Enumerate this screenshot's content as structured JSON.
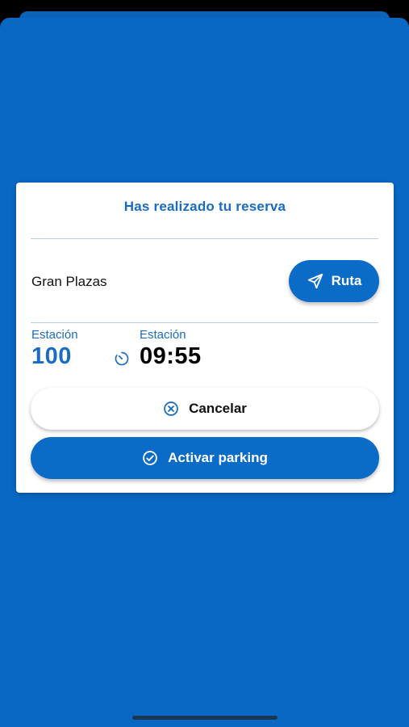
{
  "dialog": {
    "title": "Has realizado tu reserva",
    "place_name": "Gran Plazas",
    "route_button": {
      "label": "Ruta",
      "icon": "send-icon"
    },
    "station": {
      "label": "Estación",
      "value": "100"
    },
    "time": {
      "label": "Estación",
      "value": "09:55",
      "icon": "timer-icon"
    },
    "cancel_button": {
      "label": "Cancelar",
      "icon": "x-circle-icon"
    },
    "activate_button": {
      "label": "Activar parking",
      "icon": "check-circle-icon"
    }
  },
  "colors": {
    "background_blue": "#0868c4",
    "accent_blue": "#1a6cbf",
    "button_blue": "#0b6cc7",
    "white": "#ffffff",
    "text_dark": "#111111"
  }
}
